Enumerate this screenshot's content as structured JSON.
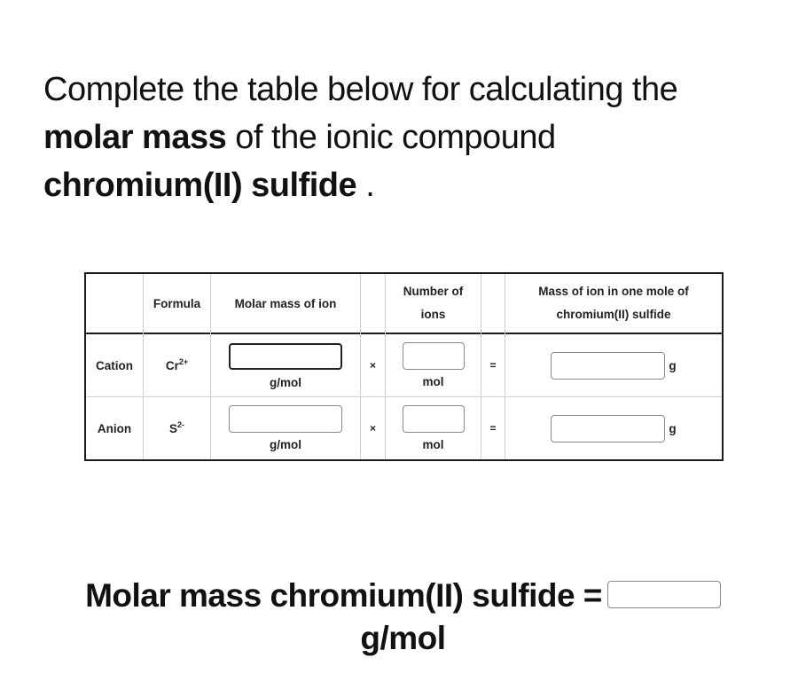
{
  "prompt": {
    "part1": "Complete the table below for calculating the ",
    "bold1": "molar mass",
    "part2": " of the ionic compound ",
    "bold2": "chromium(II) sulfide",
    "part3": " ."
  },
  "table": {
    "headers": {
      "formula": "Formula",
      "molar_mass": "Molar mass of ion",
      "number_line1": "Number of",
      "number_line2": "ions",
      "mass_line1": "Mass of ion in one mole of",
      "mass_line2": "chromium(II) sulfide"
    },
    "rows": [
      {
        "label": "Cation",
        "formula_base": "Cr",
        "formula_charge": "2+",
        "molar_mass_value": "",
        "molar_mass_unit": "g/mol",
        "times": "×",
        "number_value": "",
        "number_unit": "mol",
        "equals": "=",
        "mass_value": "",
        "mass_unit": "g"
      },
      {
        "label": "Anion",
        "formula_base": "S",
        "formula_charge": "2-",
        "molar_mass_value": "",
        "molar_mass_unit": "g/mol",
        "times": "×",
        "number_value": "",
        "number_unit": "mol",
        "equals": "=",
        "mass_value": "",
        "mass_unit": "g"
      }
    ]
  },
  "final": {
    "label": "Molar mass chromium(II) sulfide =",
    "value": "",
    "unit": "g/mol"
  }
}
